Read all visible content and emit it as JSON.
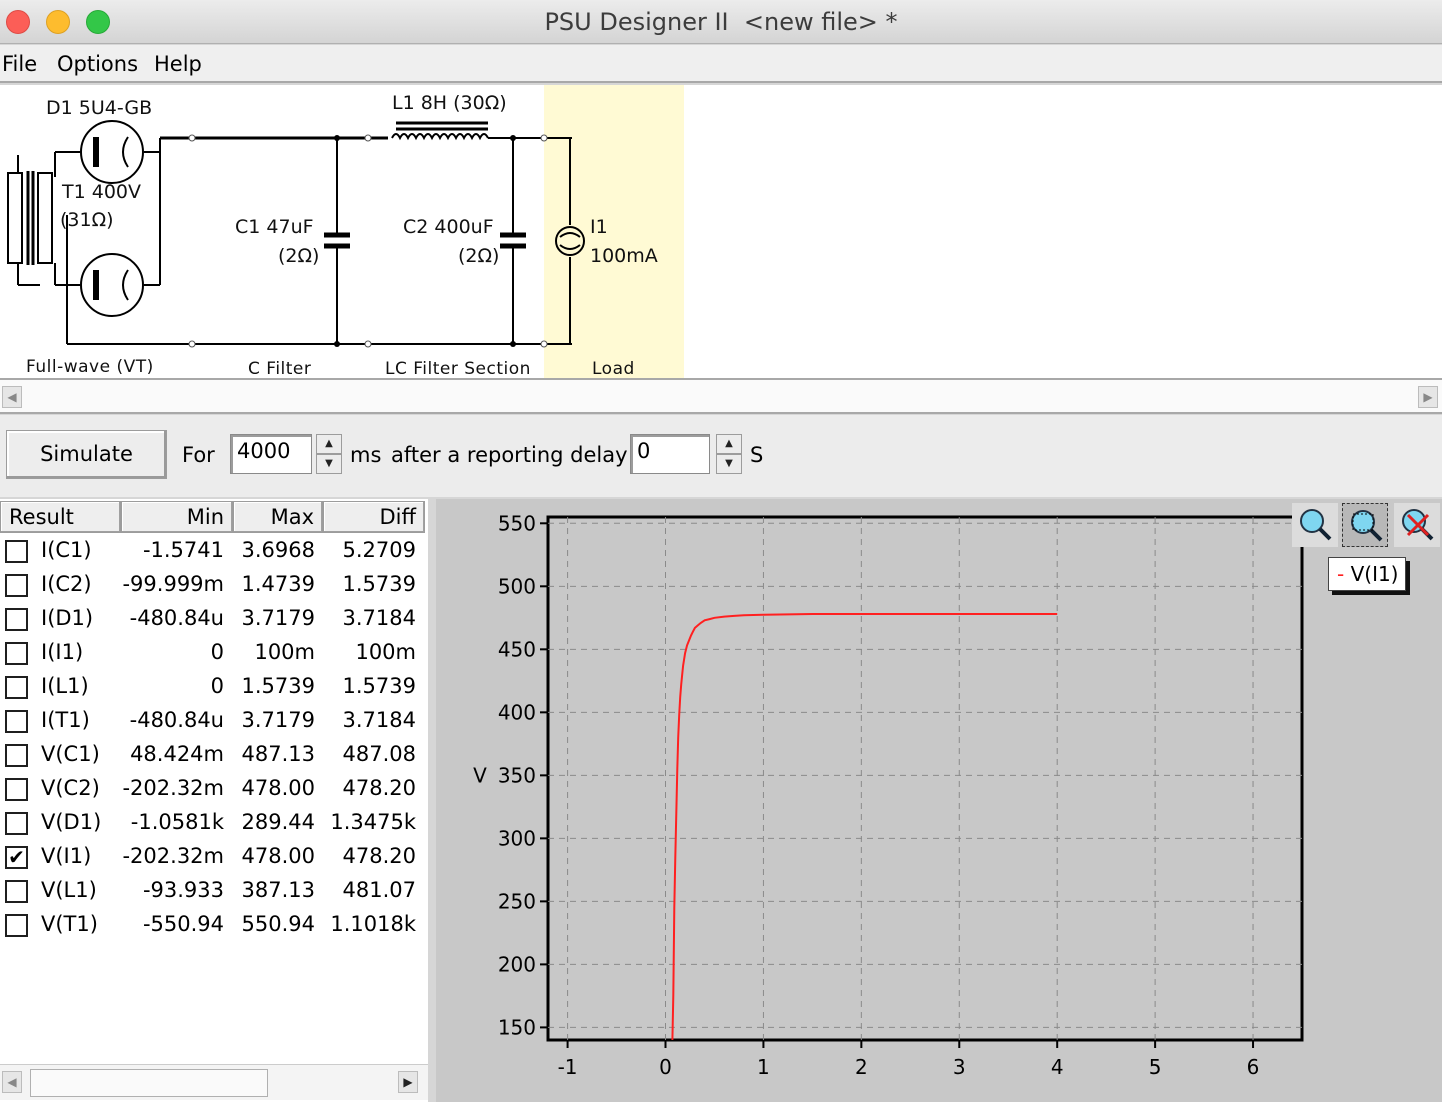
{
  "window": {
    "title": "PSU Designer II  <new file> *"
  },
  "menu": {
    "file": "File",
    "options": "Options",
    "help": "Help"
  },
  "schematic": {
    "d1_label": "D1 5U4-GB",
    "t1_label": "T1 400V",
    "t1_sub": "(31Ω)",
    "l1_label": "L1 8H (30Ω)",
    "c1_label": "C1 47uF",
    "c1_sub": "(2Ω)",
    "c2_label": "C2 400uF",
    "c2_sub": "(2Ω)",
    "i1_label": "I1",
    "i1_sub": "100mA",
    "sections": [
      "Full-wave (VT)",
      "C Filter",
      "LC Filter Section",
      "Load"
    ]
  },
  "sim": {
    "button": "Simulate",
    "for_label": "For",
    "duration": "4000",
    "ms_label": "ms",
    "delay_label": "after a reporting delay of",
    "delay": "0",
    "s_label": "S"
  },
  "results": {
    "headers": {
      "result": "Result",
      "min": "Min",
      "max": "Max",
      "diff": "Diff"
    },
    "rows": [
      {
        "name": "I(C1)",
        "min": "-1.5741",
        "max": "3.6968",
        "diff": "5.2709",
        "checked": false
      },
      {
        "name": "I(C2)",
        "min": "-99.999m",
        "max": "1.4739",
        "diff": "1.5739",
        "checked": false
      },
      {
        "name": "I(D1)",
        "min": "-480.84u",
        "max": "3.7179",
        "diff": "3.7184",
        "checked": false
      },
      {
        "name": "I(I1)",
        "min": "0",
        "max": "100m",
        "diff": "100m",
        "checked": false
      },
      {
        "name": "I(L1)",
        "min": "0",
        "max": "1.5739",
        "diff": "1.5739",
        "checked": false
      },
      {
        "name": "I(T1)",
        "min": "-480.84u",
        "max": "3.7179",
        "diff": "3.7184",
        "checked": false
      },
      {
        "name": "V(C1)",
        "min": "48.424m",
        "max": "487.13",
        "diff": "487.08",
        "checked": false
      },
      {
        "name": "V(C2)",
        "min": "-202.32m",
        "max": "478.00",
        "diff": "478.20",
        "checked": false
      },
      {
        "name": "V(D1)",
        "min": "-1.0581k",
        "max": "289.44",
        "diff": "1.3475k",
        "checked": false
      },
      {
        "name": "V(I1)",
        "min": "-202.32m",
        "max": "478.00",
        "diff": "478.20",
        "checked": true
      },
      {
        "name": "V(L1)",
        "min": "-93.933",
        "max": "387.13",
        "diff": "481.07",
        "checked": false
      },
      {
        "name": "V(T1)",
        "min": "-550.94",
        "max": "550.94",
        "diff": "1.1018k",
        "checked": false
      }
    ]
  },
  "plot": {
    "legend": "V(I1)",
    "zoom_buttons": [
      "zoom-in-icon",
      "zoom-select-icon",
      "zoom-reset-icon"
    ]
  },
  "chart_data": {
    "type": "line",
    "ylabel": "V",
    "xlabel": "",
    "xlim": [
      -1.2,
      6.5
    ],
    "ylim": [
      140,
      555
    ],
    "xticks": [
      -1,
      0,
      1,
      2,
      3,
      4,
      5,
      6
    ],
    "yticks": [
      150,
      200,
      250,
      300,
      350,
      400,
      450,
      500,
      550
    ],
    "series": [
      {
        "name": "V(I1)",
        "color": "#ff2020",
        "x": [
          0.07,
          0.08,
          0.09,
          0.1,
          0.11,
          0.12,
          0.13,
          0.14,
          0.15,
          0.16,
          0.17,
          0.18,
          0.19,
          0.2,
          0.22,
          0.24,
          0.26,
          0.28,
          0.3,
          0.33,
          0.36,
          0.4,
          0.45,
          0.5,
          0.6,
          0.7,
          0.8,
          1.0,
          1.5,
          2.0,
          3.0,
          4.0
        ],
        "y": [
          140,
          175,
          245,
          285,
          320,
          355,
          380,
          398,
          412,
          422,
          430,
          437,
          442,
          447,
          453,
          457,
          461,
          464,
          467,
          469,
          471,
          473,
          474,
          475,
          476,
          476.5,
          477,
          477.5,
          478,
          478,
          478,
          478
        ]
      }
    ]
  }
}
